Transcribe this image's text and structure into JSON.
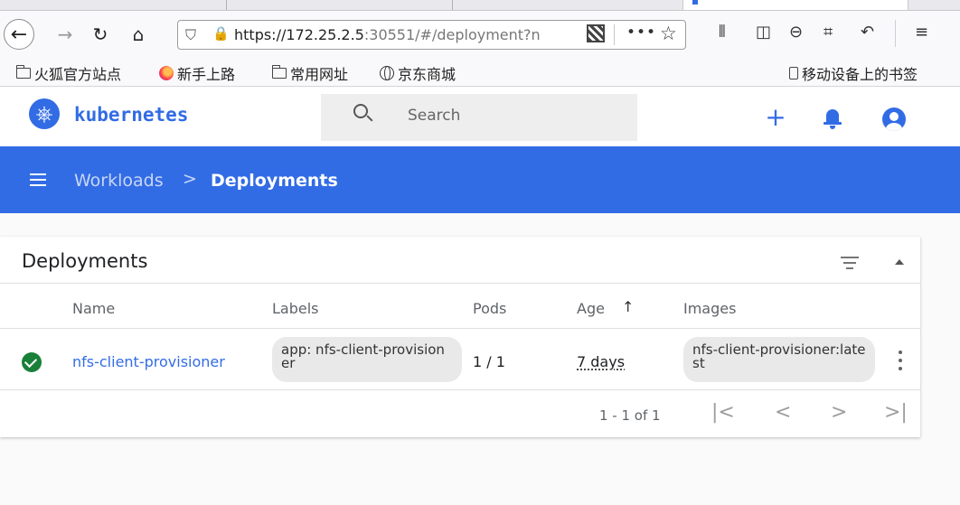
{
  "browser": {
    "url_host": "https://172.25.2.5",
    "url_rest": ":30551/#/deployment?n",
    "bookmarks": [
      {
        "label": "火狐官方站点",
        "icon": "folder-icon"
      },
      {
        "label": "新手上路",
        "icon": "firefox-icon"
      },
      {
        "label": "常用网址",
        "icon": "folder-icon"
      },
      {
        "label": "京东商城",
        "icon": "globe-icon"
      }
    ],
    "mobile_bookmarks": "移动设备上的书签"
  },
  "header": {
    "app_name": "kubernetes",
    "search_placeholder": "Search"
  },
  "breadcrumb": {
    "parent": "Workloads",
    "separator": ">",
    "current": "Deployments"
  },
  "card": {
    "title": "Deployments",
    "columns": [
      "Name",
      "Labels",
      "Pods",
      "Age",
      "Images"
    ],
    "rows": [
      {
        "status": "running",
        "name": "nfs-client-provisioner",
        "labels": "app: nfs-client-provisioner",
        "pods": "1 / 1",
        "age": "7 days",
        "images": "nfs-client-provisioner:latest"
      }
    ],
    "pagination": {
      "range": "1 - 1 of 1",
      "first": "|<",
      "prev": "<",
      "next": ">",
      "last": ">|"
    }
  },
  "colors": {
    "accent": "#326ce5",
    "success": "#188038"
  }
}
